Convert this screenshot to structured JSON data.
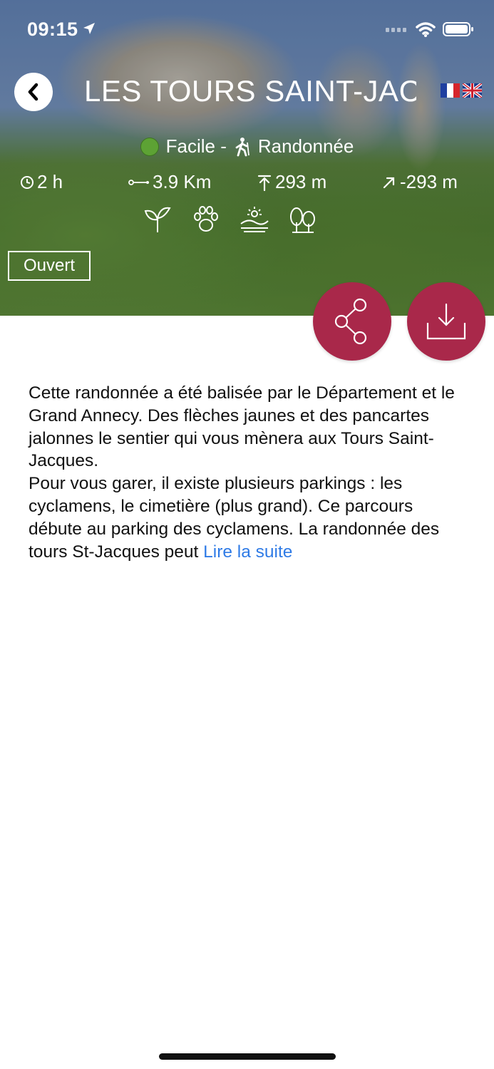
{
  "status_bar": {
    "time": "09:15",
    "icons": [
      "location-arrow-icon",
      "signal-icon",
      "wifi-icon",
      "battery-icon"
    ]
  },
  "header": {
    "title": "LES TOURS SAINT-JAC",
    "back_icon": "chevron-left-icon",
    "languages": [
      "fr-flag-icon",
      "gb-flag-icon"
    ]
  },
  "trail": {
    "difficulty": "Facile -",
    "difficulty_color": "#5da234",
    "activity": "Randonnée",
    "duration": "2 h",
    "distance": "3.9 Km",
    "elevation_gain": "293 m",
    "elevation_loss": "-293 m",
    "themes": [
      "flora-icon",
      "fauna-icon",
      "landscape-icon",
      "forest-icon"
    ],
    "status": "Ouvert"
  },
  "actions": {
    "accent": "#a9284a",
    "share_icon": "share-icon",
    "download_icon": "download-icon"
  },
  "description": {
    "line1": "Cette randonnée a été balisée par le Département et le Grand Annecy. Des flèches jaunes et des pancartes jalonnes le sentier qui vous mènera aux Tours Saint-Jacques.",
    "line2": "Pour vous garer, il existe plusieurs parkings : les cyclamens, le cimetière (plus grand). Ce parcours débute au parking des cyclamens. La randonnée des tours St-Jacques peut ",
    "read_more": "Lire la suite",
    "link_color": "#2f7be6"
  }
}
